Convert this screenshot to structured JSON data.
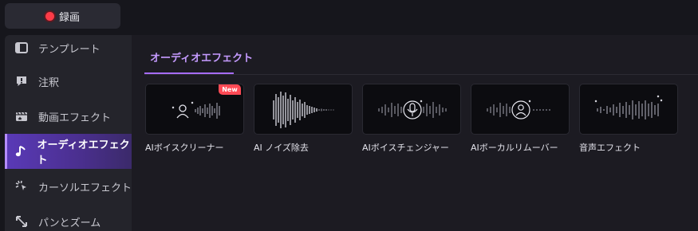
{
  "toolbar": {
    "record_label": "録画"
  },
  "sidebar": {
    "items": [
      {
        "label": "テンプレート",
        "icon": "template-icon"
      },
      {
        "label": "注釈",
        "icon": "annotation-icon"
      },
      {
        "label": "動画エフェクト",
        "icon": "video-effect-icon"
      },
      {
        "label": "オーディオエフェクト",
        "icon": "audio-effect-icon",
        "active": true
      },
      {
        "label": "カーソルエフェクト",
        "icon": "cursor-effect-icon"
      },
      {
        "label": "パンとズーム",
        "icon": "pan-zoom-icon"
      }
    ]
  },
  "main": {
    "tab_label": "オーディオエフェクト",
    "cards": [
      {
        "label": "AIボイスクリーナー",
        "badge": "New",
        "icon": "voice-cleaner-icon"
      },
      {
        "label": "AI ノイズ除去",
        "icon": "noise-removal-waveform-icon"
      },
      {
        "label": "AIボイスチェンジャー",
        "icon": "microphone-icon"
      },
      {
        "label": "AIボーカルリムーバー",
        "icon": "vocal-remover-icon"
      },
      {
        "label": "音声エフェクト",
        "icon": "sound-effect-waveform-icon"
      }
    ]
  },
  "colors": {
    "accent": "#a66cff",
    "record": "#ff3b47",
    "badge": "#ff4a55"
  }
}
